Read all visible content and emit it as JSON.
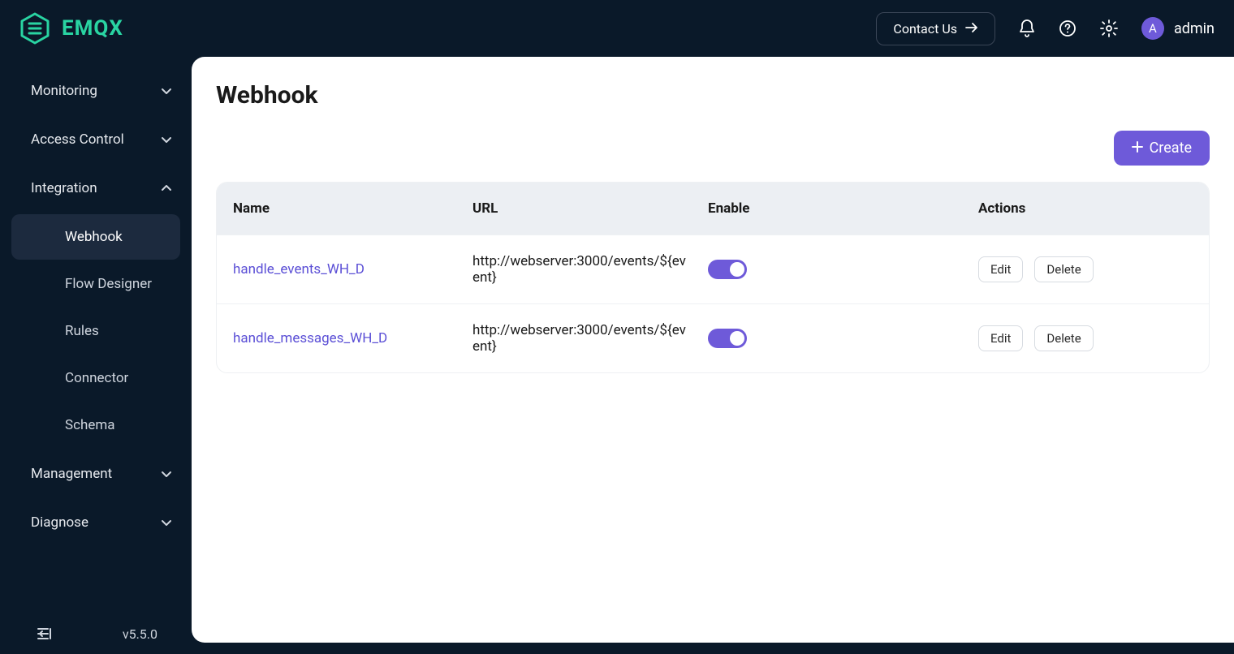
{
  "brand": {
    "name": "EMQX"
  },
  "header": {
    "contact_label": "Contact Us",
    "user_initial": "A",
    "username": "admin"
  },
  "sidebar": {
    "items": [
      {
        "label": "Monitoring",
        "expanded": false,
        "children": []
      },
      {
        "label": "Access Control",
        "expanded": false,
        "children": []
      },
      {
        "label": "Integration",
        "expanded": true,
        "children": [
          {
            "label": "Webhook",
            "active": true
          },
          {
            "label": "Flow Designer",
            "active": false
          },
          {
            "label": "Rules",
            "active": false
          },
          {
            "label": "Connector",
            "active": false
          },
          {
            "label": "Schema",
            "active": false
          }
        ]
      },
      {
        "label": "Management",
        "expanded": false,
        "children": []
      },
      {
        "label": "Diagnose",
        "expanded": false,
        "children": []
      }
    ],
    "version": "v5.5.0"
  },
  "page": {
    "title": "Webhook",
    "create_label": "Create",
    "columns": {
      "name": "Name",
      "url": "URL",
      "enable": "Enable",
      "actions": "Actions"
    },
    "edit_label": "Edit",
    "delete_label": "Delete",
    "rows": [
      {
        "name": "handle_events_WH_D",
        "url": "http://webserver:3000/events/${event}",
        "enabled": true
      },
      {
        "name": "handle_messages_WH_D",
        "url": "http://webserver:3000/events/${event}",
        "enabled": true
      }
    ]
  }
}
